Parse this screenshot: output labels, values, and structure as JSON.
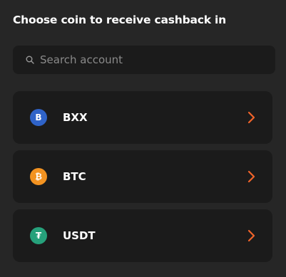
{
  "header": {
    "title": "Choose coin to receive cashback in"
  },
  "search": {
    "placeholder": "Search account",
    "value": "",
    "icon": "search-icon"
  },
  "coins": [
    {
      "symbol": "BXX",
      "logo_glyph": "B",
      "logo_color": "#2f63c8",
      "icon": "bxx-logo-icon"
    },
    {
      "symbol": "BTC",
      "logo_glyph": "₿",
      "logo_color": "#f39321",
      "icon": "bitcoin-logo-icon"
    },
    {
      "symbol": "USDT",
      "logo_glyph": "₮",
      "logo_color": "#26a17b",
      "icon": "tether-logo-icon"
    }
  ],
  "colors": {
    "background": "#262626",
    "card": "#1b1b1b",
    "accent_chevron": "#f0642a"
  }
}
